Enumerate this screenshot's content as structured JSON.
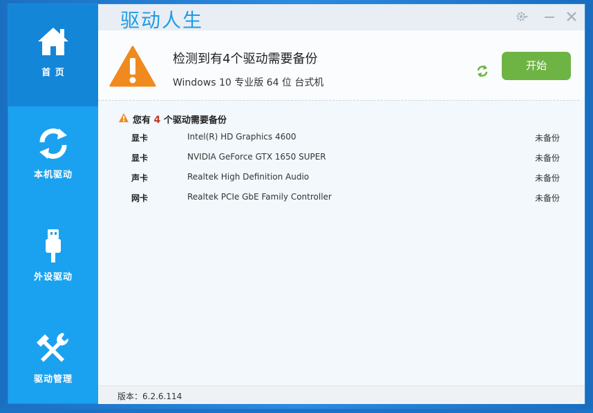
{
  "app": {
    "brand": "驱动人生"
  },
  "sidebar": {
    "items": [
      {
        "label": "首 页",
        "icon": "home-icon",
        "active": true
      },
      {
        "label": "本机驱动",
        "icon": "refresh-arrows-icon"
      },
      {
        "label": "外设驱动",
        "icon": "usb-icon"
      },
      {
        "label": "驱动管理",
        "icon": "tools-icon"
      }
    ]
  },
  "header": {
    "headline": "检测到有4个驱动需要备份",
    "subline": "Windows 10 专业版 64 位 台式机",
    "start_label": "开始"
  },
  "list": {
    "title_prefix": "您有",
    "count": "4",
    "title_suffix": "个驱动需要备份",
    "rows": [
      {
        "type": "显卡",
        "name": "Intel(R) HD Graphics 4600",
        "status": "未备份"
      },
      {
        "type": "显卡",
        "name": "NVIDIA GeForce GTX 1650 SUPER",
        "status": "未备份"
      },
      {
        "type": "声卡",
        "name": "Realtek High Definition Audio",
        "status": "未备份"
      },
      {
        "type": "网卡",
        "name": "Realtek PCIe GbE Family Controller",
        "status": "未备份"
      }
    ]
  },
  "footer": {
    "version": "版本：6.2.6.114"
  },
  "colors": {
    "accent": "#1aa2f0",
    "active": "#1386d8",
    "start": "#6db445",
    "warning": "#f08a1e"
  }
}
